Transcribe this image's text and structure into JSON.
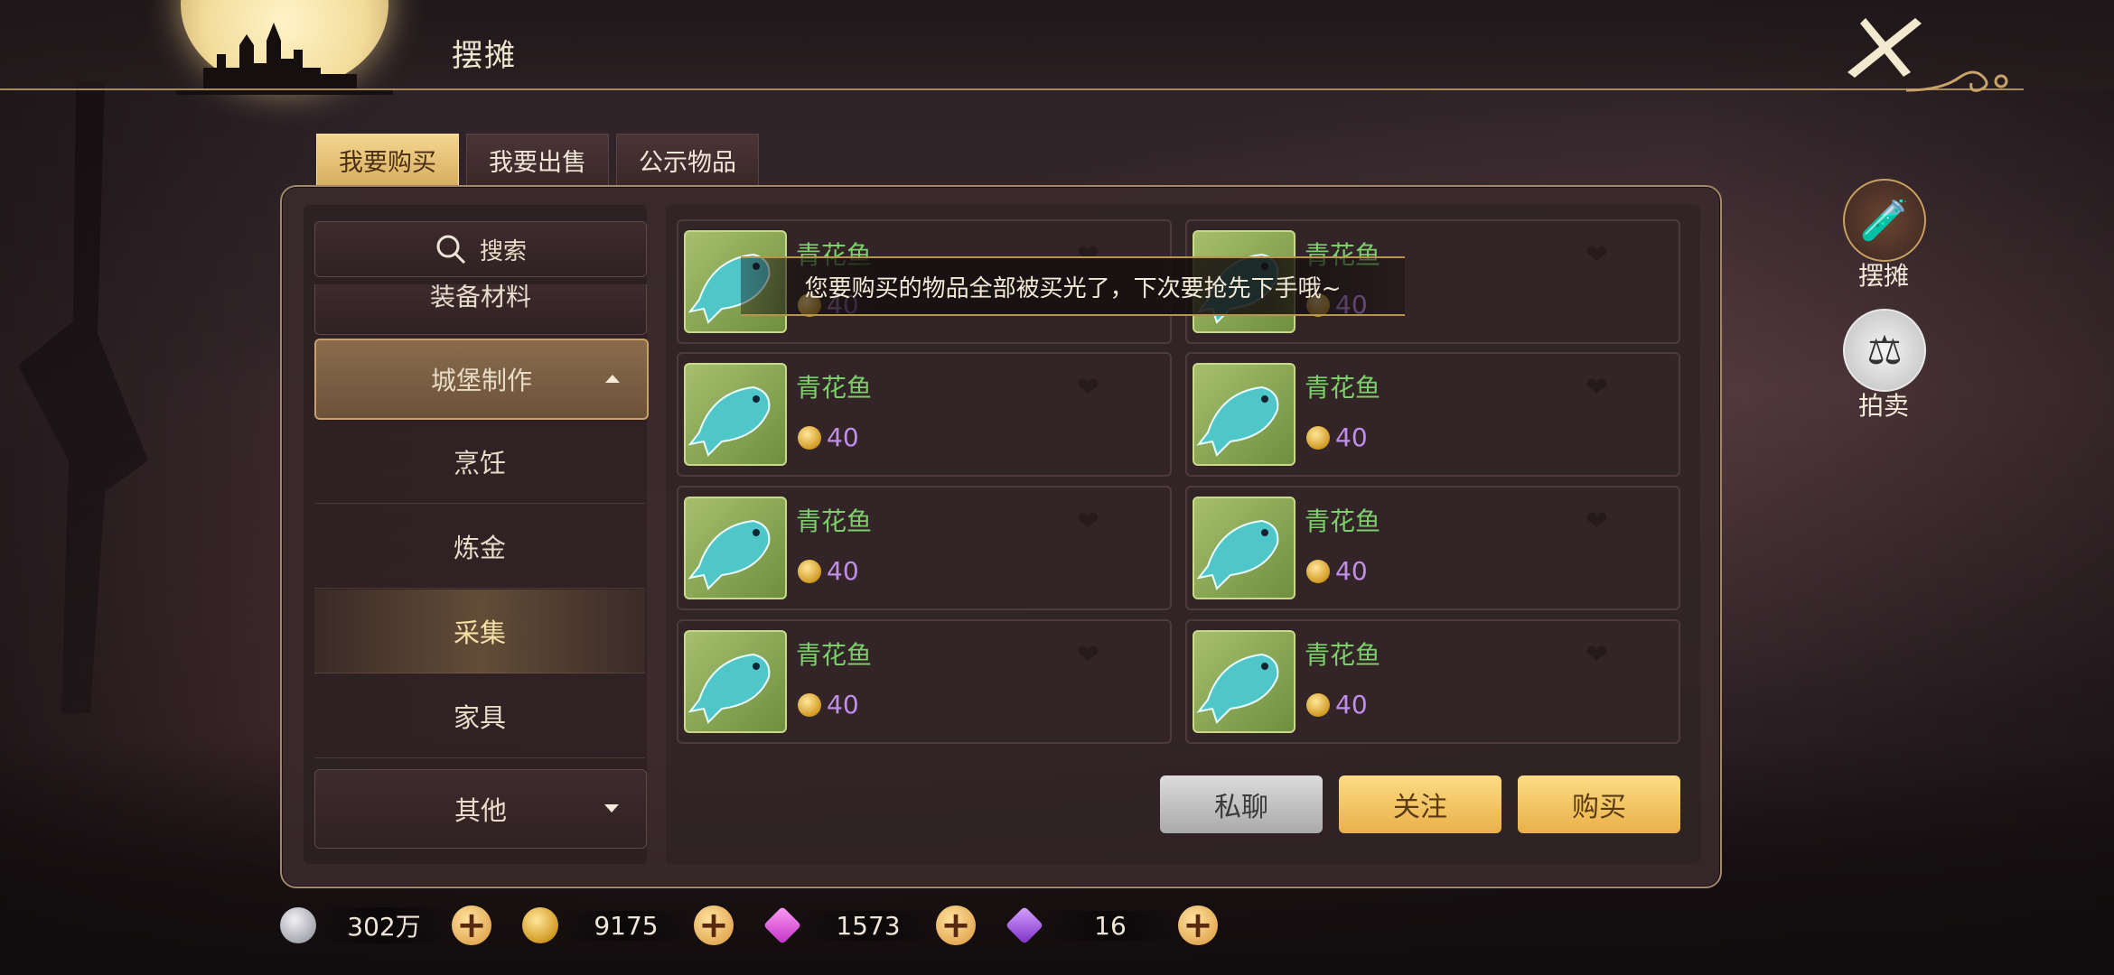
{
  "header": {
    "title": "摆摊"
  },
  "tabs": [
    {
      "label": "我要购买",
      "active": true
    },
    {
      "label": "我要出售",
      "active": false
    },
    {
      "label": "公示物品",
      "active": false
    }
  ],
  "sidebar": {
    "search_label": "搜索",
    "partial_category": "装备材料",
    "expanded_category": "城堡制作",
    "subcategories": [
      "烹饪",
      "炼金",
      "采集",
      "家具"
    ],
    "active_subcategory": "采集",
    "other_category": "其他"
  },
  "items": [
    {
      "name": "青花鱼",
      "price": "40"
    },
    {
      "name": "青花鱼",
      "price": "40"
    },
    {
      "name": "青花鱼",
      "price": "40"
    },
    {
      "name": "青花鱼",
      "price": "40"
    },
    {
      "name": "青花鱼",
      "price": "40"
    },
    {
      "name": "青花鱼",
      "price": "40"
    },
    {
      "name": "青花鱼",
      "price": "40"
    },
    {
      "name": "青花鱼",
      "price": "40"
    }
  ],
  "toast": "您要购买的物品全部被买光了，下次要抢先下手哦~",
  "buttons": {
    "chat": "私聊",
    "follow": "关注",
    "buy": "购买"
  },
  "side_menu": [
    {
      "label": "摆摊",
      "icon": "stall-icon"
    },
    {
      "label": "拍卖",
      "icon": "auction-icon"
    }
  ],
  "currencies": [
    {
      "name": "silver-coin-icon",
      "value": "302万",
      "color": "#b9b9c2"
    },
    {
      "name": "gold-coin-icon",
      "value": "9175",
      "color": "#e4a62c"
    },
    {
      "name": "pink-gem-icon",
      "value": "1573",
      "color": "#d24dd6"
    },
    {
      "name": "purple-gem-icon",
      "value": "16",
      "color": "#a24de0"
    }
  ]
}
